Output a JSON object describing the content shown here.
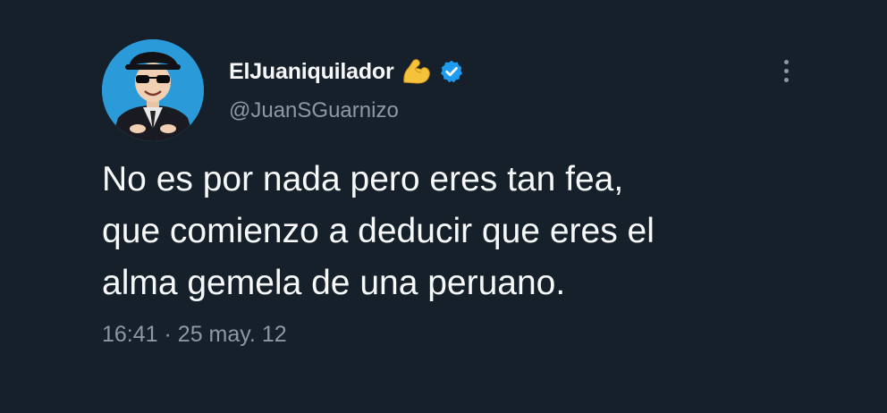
{
  "user": {
    "display_name": "ElJuaniquilador",
    "handle": "@JuanSGuarnizo",
    "avatar_icon": "user-avatar",
    "emoji_icon": "flexed-biceps-icon",
    "verified_icon": "verified-badge-icon",
    "verified_color": "#1d9bf0"
  },
  "tweet": {
    "lines": [
      "No es por nada pero eres tan fea,",
      "que comienzo a deducir que eres el",
      "alma gemela de una peruano."
    ],
    "time": "16:41",
    "separator": "·",
    "date": "25 may. 12"
  },
  "menu": {
    "icon": "more-options-icon"
  },
  "colors": {
    "background": "#15202b",
    "primary_text": "#f7f9f9",
    "secondary_text": "#8b98a5",
    "avatar_bg": "#2a9ad8"
  }
}
